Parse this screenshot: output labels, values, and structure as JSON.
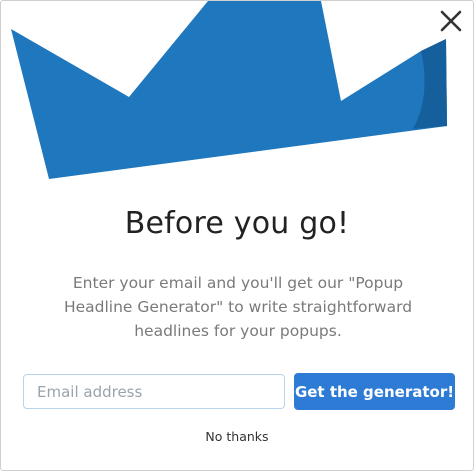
{
  "popup": {
    "headline": "Before you go!",
    "body": "Enter your email and you'll get our \"Popup Headline Generator\" to write straightforward headlines for your popups.",
    "email_placeholder": "Email address",
    "cta_label": "Get the generator!",
    "decline_label": "No thanks"
  },
  "icons": {
    "close": "close-icon",
    "crown": "crown-graphic"
  },
  "colors": {
    "crown_primary": "#1f77bd",
    "crown_shadow": "#155f9c",
    "cta_background": "#2e7bd6",
    "input_border": "#b9d4ea"
  }
}
